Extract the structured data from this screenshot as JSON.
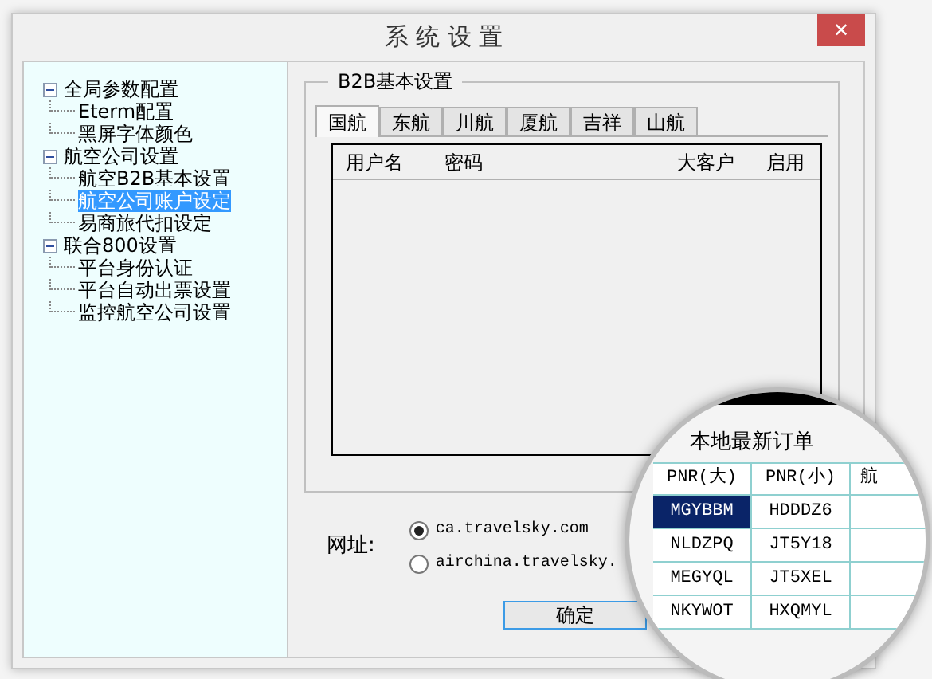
{
  "window": {
    "title": "系 统 设 置",
    "close": "✕"
  },
  "tree": [
    {
      "label": "全局参数配置",
      "expanded": true,
      "selected": false,
      "children": [
        {
          "label": "Eterm配置",
          "selected": false
        },
        {
          "label": "黑屏字体颜色",
          "selected": false
        }
      ]
    },
    {
      "label": "航空公司设置",
      "expanded": true,
      "selected": false,
      "children": [
        {
          "label": "航空B2B基本设置",
          "selected": false
        },
        {
          "label": "航空公司账户设定",
          "selected": true
        },
        {
          "label": "易商旅代扣设定",
          "selected": false
        }
      ]
    },
    {
      "label": "联合800设置",
      "expanded": true,
      "selected": false,
      "children": [
        {
          "label": "平台身份认证",
          "selected": false
        },
        {
          "label": "平台自动出票设置",
          "selected": false
        },
        {
          "label": "监控航空公司设置",
          "selected": false
        }
      ]
    }
  ],
  "group_title": "B2B基本设置",
  "tabs": [
    {
      "label": "国航",
      "selected": true
    },
    {
      "label": "东航",
      "selected": false
    },
    {
      "label": "川航",
      "selected": false
    },
    {
      "label": "厦航",
      "selected": false
    },
    {
      "label": "吉祥",
      "selected": false
    },
    {
      "label": "山航",
      "selected": false
    }
  ],
  "table": {
    "columns": [
      "用户名",
      "密码",
      "大客户",
      "启用"
    ]
  },
  "url": {
    "label": "网址:",
    "options": [
      {
        "label": "ca.travelsky.com",
        "selected": true
      },
      {
        "label": "airchina.travelsky.",
        "selected": false
      }
    ]
  },
  "ok_button": "确定",
  "magnifier": {
    "title": "本地最新订单",
    "columns": [
      "PNR(大)",
      "PNR(小)",
      "航"
    ],
    "rows": [
      {
        "cells": [
          "MGYBBM",
          "HDDDZ6"
        ],
        "selected": true
      },
      {
        "cells": [
          "NLDZPQ",
          "JT5Y18"
        ],
        "selected": false
      },
      {
        "cells": [
          "MEGYQL",
          "JT5XEL"
        ],
        "selected": false
      },
      {
        "cells": [
          "NKYWOT",
          "HXQMYL"
        ],
        "selected": false
      }
    ]
  }
}
